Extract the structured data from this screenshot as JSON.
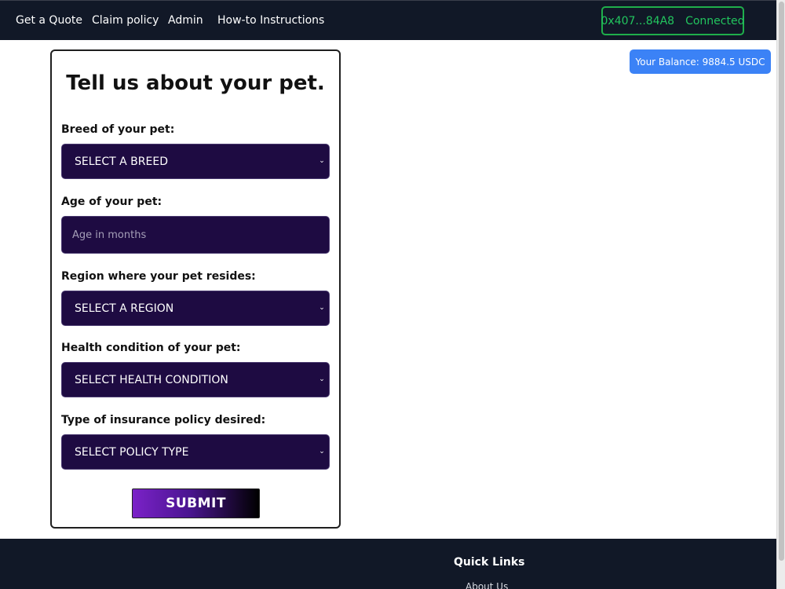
{
  "nav": {
    "links": [
      "Get a Quote",
      "Claim policy",
      "Admin",
      "How-to Instructions"
    ],
    "wallet_address": "0x407...84A8",
    "wallet_status": "Connected"
  },
  "balance": "Your Balance: 9884.5 USDC",
  "form": {
    "title": "Tell us about your pet.",
    "breed_label": "Breed of your pet:",
    "breed_value": "SELECT A BREED",
    "age_label": "Age of your pet:",
    "age_placeholder": "Age in months",
    "region_label": "Region where your pet resides:",
    "region_value": "SELECT A REGION",
    "health_label": "Health condition of your pet:",
    "health_value": "SELECT HEALTH CONDITION",
    "policy_label": "Type of insurance policy desired:",
    "policy_value": "SELECT POLICY TYPE",
    "submit_label": "SUBMIT",
    "dropdown_arrow": "⌄"
  },
  "footer": {
    "heading": "Quick Links",
    "links": [
      "About Us"
    ]
  },
  "colors": {
    "nav_bg": "#111827",
    "connected_green": "#22c55e",
    "balance_blue": "#3b82f6",
    "field_bg": "#1e0b42"
  }
}
